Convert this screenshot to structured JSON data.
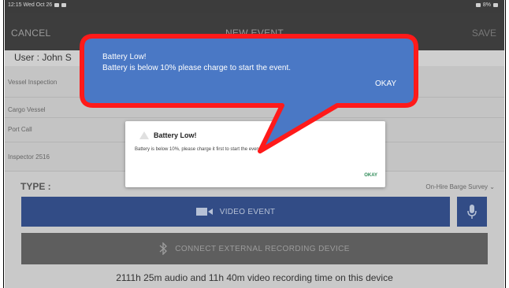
{
  "statusbar": {
    "time_date": "12:15  Wed Oct 26",
    "right_text": "8%"
  },
  "appbar": {
    "cancel_label": "CANCEL",
    "title": "NEW EVENT",
    "save_label": "SAVE"
  },
  "form": {
    "user": "User : John S",
    "fields": [
      "Vessel Inspection",
      "Cargo Vessel",
      "Port Call",
      "Inspector 2516"
    ],
    "type_label": "TYPE :",
    "type_value": "On-Hire Barge Survey"
  },
  "buttons": {
    "video_event": "VIDEO EVENT",
    "external_device": "CONNECT EXTERNAL RECORDING DEVICE"
  },
  "footer_text": "2111h 25m audio and 11h 40m video recording time on this device",
  "dialog": {
    "title": "Battery Low!",
    "message": "Battery is below 10%, please charge it first to start the event.",
    "ok_label": "OKAY"
  },
  "callout": {
    "line1": "Battery Low!",
    "line2": "Battery is below 10% please charge to start the event.",
    "ok_label": "OKAY",
    "fill_color": "#4a78c5",
    "border_color": "#ff1a1a"
  },
  "colors": {
    "primary_button": "#324c86",
    "secondary_button": "#5e5e5e",
    "appbar": "#3d3d3d"
  }
}
